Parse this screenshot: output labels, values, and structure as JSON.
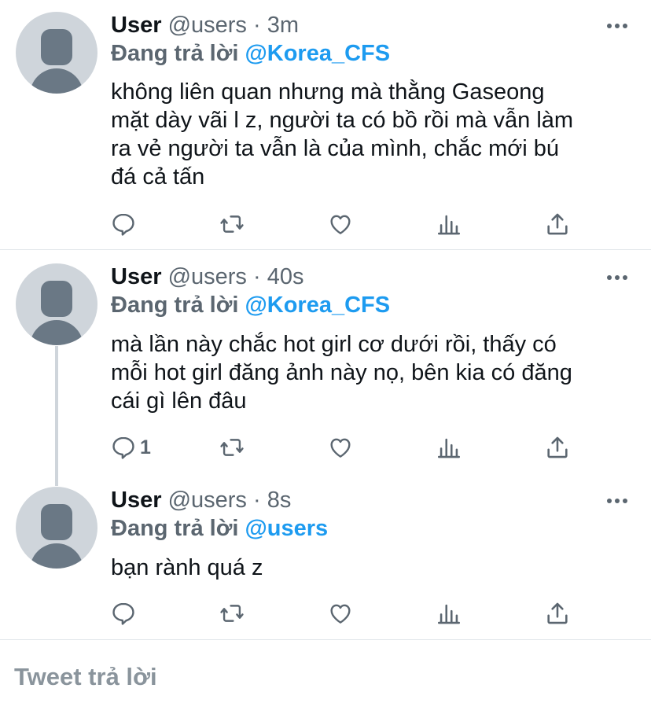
{
  "tweets": [
    {
      "name": "User",
      "handle": "@users",
      "dot": "·",
      "time": "3m",
      "reply_prefix": "Đang trả lời",
      "reply_to": "@Korea_CFS",
      "lines": [
        "không liên quan nhưng mà thằng Gaseong",
        "mặt dày vãi l z, người ta có bồ rồi mà vẫn làm",
        "ra vẻ người ta vẫn là của mình, chắc mới bú",
        "đá cả tấn"
      ],
      "reply_count": ""
    },
    {
      "name": "User",
      "handle": "@users",
      "dot": "·",
      "time": "40s",
      "reply_prefix": "Đang trả lời",
      "reply_to": "@Korea_CFS",
      "lines": [
        "mà lần này chắc hot girl cơ dưới rồi, thấy có",
        "mỗi hot girl đăng ảnh này nọ, bên kia có đăng",
        "cái gì lên đâu"
      ],
      "reply_count": "1"
    },
    {
      "name": "User",
      "handle": "@users",
      "dot": "·",
      "time": "8s",
      "reply_prefix": "Đang trả lời",
      "reply_to": "@users",
      "lines": [
        "bạn rành quá z"
      ],
      "reply_count": ""
    }
  ],
  "compose": {
    "placeholder": "Tweet trả lời"
  },
  "icons": {
    "reply": "reply-icon",
    "retweet": "retweet-icon",
    "like": "heart-icon",
    "analytics": "analytics-icon",
    "share": "share-icon",
    "more": "more-icon"
  },
  "colors": {
    "mention": "#1d9bf0",
    "secondary_text": "#5b6670",
    "icon": "#5b6670",
    "avatar_bg": "#cfd5db",
    "avatar_fg": "#6a7885"
  }
}
